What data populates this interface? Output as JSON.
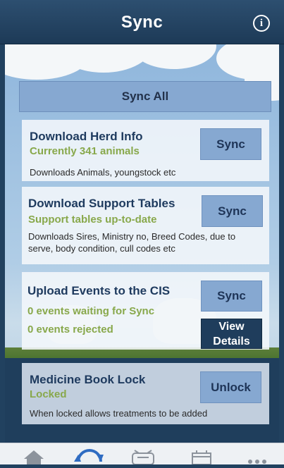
{
  "header": {
    "title": "Sync",
    "info_icon": "info-icon"
  },
  "sync_all": {
    "label": "Sync All"
  },
  "cards": {
    "herd": {
      "title": "Download Herd Info",
      "status": "Currently 341 animals",
      "description": "Downloads Animals, youngstock etc",
      "button": "Sync"
    },
    "support": {
      "title": "Download Support Tables",
      "status": "Support tables up-to-date",
      "description": "Downloads Sires, Ministry no, Breed Codes, due to serve, body condition, cull codes etc",
      "button": "Sync"
    },
    "upload": {
      "title": "Upload Events to the CIS",
      "waiting": "0 events waiting for Sync",
      "rejected": "0 events rejected",
      "button": "Sync",
      "details_button": "View Details"
    },
    "medicine": {
      "title": "Medicine Book Lock",
      "status": "Locked",
      "description": "When locked allows treatments to be added",
      "button": "Unlock"
    }
  },
  "tabbar": {
    "items": [
      {
        "icon": "home-icon",
        "active": false
      },
      {
        "icon": "sync-icon",
        "active": true
      },
      {
        "icon": "cow-icon",
        "active": false
      },
      {
        "icon": "calendar-icon",
        "active": false
      },
      {
        "icon": "more-icon",
        "active": false
      }
    ]
  },
  "colors": {
    "header": "#1f3d5c",
    "accent_button": "#86a8d1",
    "status_green": "#88a84b",
    "title_navy": "#1e3a5e",
    "active_tab": "#2f6cc2"
  }
}
